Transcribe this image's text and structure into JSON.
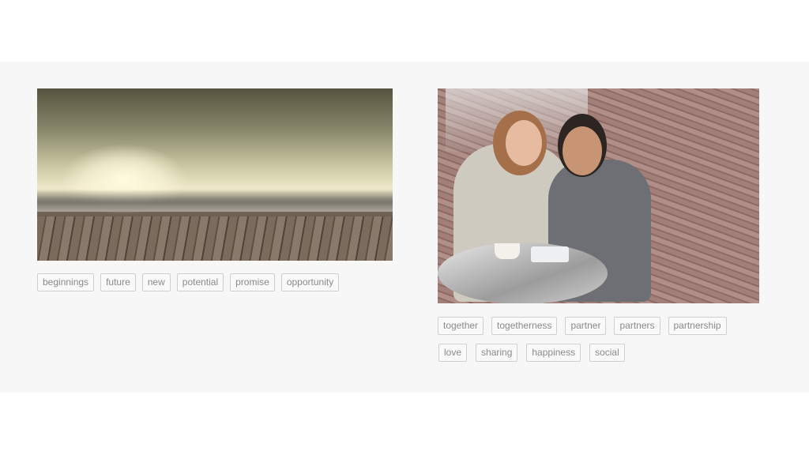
{
  "cards": [
    {
      "image_desc_icon": "city-skyline-deck-photo",
      "tags": [
        "beginnings",
        "future",
        "new",
        "potential",
        "promise",
        "opportunity"
      ]
    },
    {
      "image_desc_icon": "couple-cafe-photo",
      "tags": [
        "together",
        "togetherness",
        "partner",
        "partners",
        "partnership",
        "love",
        "sharing",
        "happiness",
        "social"
      ]
    }
  ]
}
